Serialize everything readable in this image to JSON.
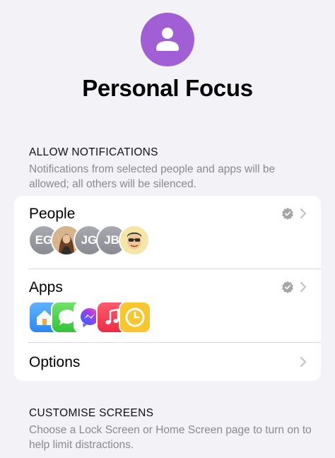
{
  "header": {
    "icon": "person-icon",
    "icon_bg": "#a15fd6",
    "title": "Personal Focus"
  },
  "allow_notifications": {
    "header": "ALLOW NOTIFICATIONS",
    "footer": "Notifications from selected people and apps will be allowed; all others will be silenced."
  },
  "card": {
    "people": {
      "label": "People",
      "avatars": [
        {
          "kind": "initials",
          "text": "EG"
        },
        {
          "kind": "photo",
          "text": ""
        },
        {
          "kind": "initials",
          "text": "JG"
        },
        {
          "kind": "initials",
          "text": "JB"
        },
        {
          "kind": "memoji",
          "text": ""
        }
      ]
    },
    "apps": {
      "label": "Apps",
      "icons": [
        "home-app-icon",
        "messages-app-icon",
        "messenger-app-icon",
        "music-app-icon",
        "clock-app-icon"
      ]
    },
    "options": {
      "label": "Options"
    }
  },
  "customise_screens": {
    "header": "CUSTOMISE SCREENS",
    "footer": "Choose a Lock Screen or Home Screen page to turn on to help limit distractions."
  },
  "colors": {
    "background": "#f2f2f7",
    "card": "#ffffff",
    "secondary_text": "#8a8a8e",
    "chevron": "#c4c4c7"
  }
}
